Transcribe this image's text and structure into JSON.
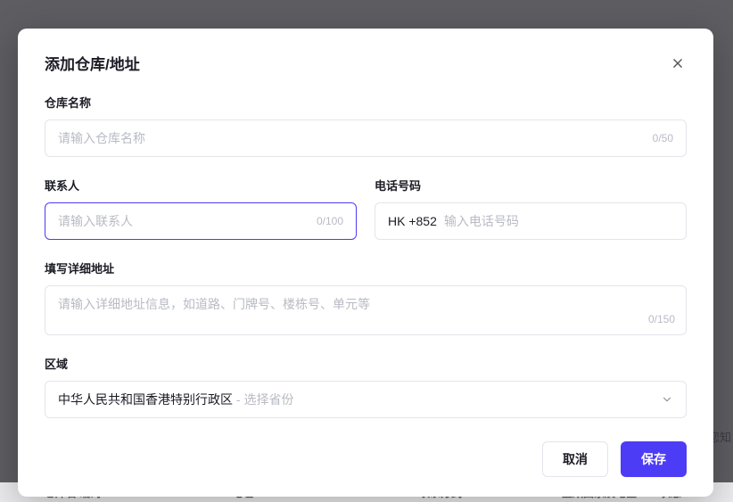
{
  "modal": {
    "title": "添加仓库/地址",
    "warehouse_name_label": "仓库名称",
    "warehouse_name_placeholder": "请输入仓库名称",
    "warehouse_name_counter": "0/50",
    "contact_label": "联系人",
    "contact_placeholder": "请输入联系人",
    "contact_counter": "0/100",
    "phone_label": "电话号码",
    "phone_prefix": "HK +852",
    "phone_placeholder": "输入电话号码",
    "address_label": "填写详细地址",
    "address_placeholder": "请输入详细地址信息，如道路、门牌号、楼栋号、单元等",
    "address_counter": "0/150",
    "region_label": "区域",
    "region_value": "中华人民共和国香港特别行政区",
    "region_separator": " - ",
    "region_placeholder": "选择省份",
    "cancel_label": "取消",
    "save_label": "保存"
  },
  "background": {
    "col1": "仓库名/编码",
    "col2": "地址",
    "col3": "联系方式",
    "col4": "生效国家及地区",
    "col5": "状态",
    "extra": "您知"
  }
}
